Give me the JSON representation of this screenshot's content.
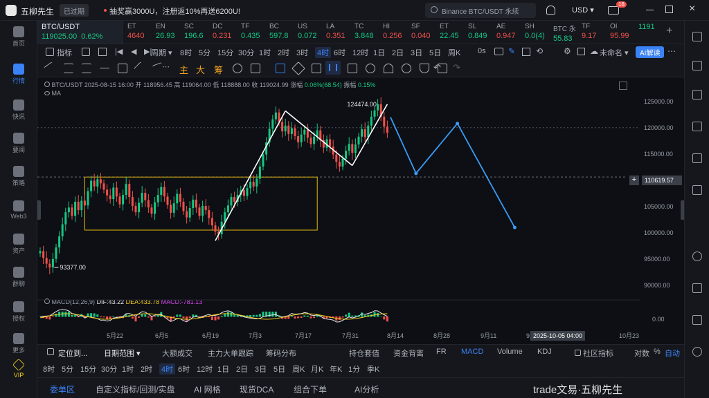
{
  "app": {
    "name": "五柳先生",
    "expired_badge": "已过期",
    "promo": "抽奖赢3000U，注册返10%再送6200U!",
    "search_placeholder": "Binance BTC/USDT 永续",
    "currency": "USD",
    "notif_count": "16"
  },
  "leftnav": [
    {
      "label": "首页"
    },
    {
      "label": "行情",
      "active": true
    },
    {
      "label": "快讯"
    },
    {
      "label": "要闻"
    },
    {
      "label": "策略"
    },
    {
      "label": "Web3"
    },
    {
      "label": "资产"
    },
    {
      "label": "群聊"
    },
    {
      "label": "授权"
    },
    {
      "label": "更多"
    },
    {
      "label": "VIP"
    }
  ],
  "tickers": [
    {
      "name": "BTC/USDT",
      "price": "119025.00",
      "change": "0.62%",
      "dir": "up"
    },
    {
      "name": "ET",
      "price": "4640",
      "dir": "dn"
    },
    {
      "name": "EN",
      "price": "26.93",
      "dir": "up"
    },
    {
      "name": "SC",
      "price": "196.6",
      "dir": "up"
    },
    {
      "name": "DC",
      "price": "0.231",
      "dir": "dn"
    },
    {
      "name": "TF",
      "price": "0.435",
      "dir": "up"
    },
    {
      "name": "BC",
      "price": "597.8",
      "dir": "up"
    },
    {
      "name": "US",
      "price": "0.072",
      "dir": "up"
    },
    {
      "name": "LA",
      "price": "0.351",
      "dir": "dn"
    },
    {
      "name": "TC",
      "price": "3.848",
      "dir": "up"
    },
    {
      "name": "HI",
      "price": "0.256",
      "dir": "dn"
    },
    {
      "name": "SF",
      "price": "0.040",
      "dir": "dn"
    },
    {
      "name": "ET",
      "price": "22.45",
      "dir": "up"
    },
    {
      "name": "SL",
      "price": "0.849",
      "dir": "up"
    },
    {
      "name": "AE",
      "price": "0.947",
      "dir": "dn"
    },
    {
      "name": "SH",
      "price": "0.0(4)",
      "dir": "up"
    },
    {
      "name": "BTC 永",
      "price": "55.83",
      "dir": "up"
    },
    {
      "name": "TF",
      "price": "9.17",
      "dir": "dn"
    },
    {
      "name": "OI",
      "price": "95.99",
      "dir": "dn"
    },
    {
      "name": "",
      "price": "1191",
      "dir": "up"
    }
  ],
  "toolbar1": {
    "indicator": "指标",
    "period": "周期",
    "intervals": [
      "8时",
      "5分",
      "15分",
      "30分",
      "1时",
      "2时",
      "3时",
      "4时",
      "6时",
      "12时",
      "1日",
      "2日",
      "3日",
      "5日",
      "周K"
    ],
    "active_interval": "4时",
    "seconds": "0s",
    "unnamed": "未命名",
    "ai_button": "AI解读"
  },
  "toolbar2": {
    "main": "主",
    "big": "大",
    "chip": "筹"
  },
  "chart_header": {
    "symbol": "BTC/USDT",
    "datetime": "2025-08-15 16:00",
    "open_label": "开",
    "open": "118956.45",
    "high_label": "高",
    "high": "119064.00",
    "low_label": "低",
    "low": "118888.00",
    "close_label": "收",
    "close": "119024.99",
    "chg_label": "涨幅",
    "chg": "0.06%(68.54)",
    "amp_label": "振幅",
    "amp": "0.15%",
    "ma": "MA"
  },
  "chart_data": {
    "type": "candlestick",
    "y_ticks": [
      "125000.00",
      "120000.00",
      "115000.00",
      "110000.00",
      "105000.00",
      "100000.00",
      "95000.00",
      "90000.00"
    ],
    "x_ticks": [
      "5月22",
      "6月5",
      "6月19",
      "7月3",
      "7月17",
      "7月31",
      "8月14",
      "8月28",
      "9月11",
      "9月2",
      "10月23"
    ],
    "crosshair_price": "110619.57",
    "crosshair_date": "2025-10-05 04:00",
    "high_label": "124474.00",
    "low_label": "93377.00",
    "close_series": [
      96500,
      95200,
      94100,
      93377,
      95000,
      97200,
      99300,
      101600,
      103900,
      104800,
      103200,
      105900,
      104300,
      106100,
      105200,
      107900,
      109900,
      108800,
      110200,
      109400,
      108200,
      107100,
      106400,
      108600,
      106900,
      105400,
      107200,
      109300,
      106800,
      105100,
      103900,
      105700,
      107600,
      106200,
      104800,
      103600,
      105800,
      107200,
      108700,
      106900,
      105300,
      103800,
      105600,
      107400,
      105900,
      104100,
      102900,
      104700,
      106300,
      104800,
      103200,
      105100,
      104300,
      102800,
      101400,
      100200,
      99700,
      102100,
      103900,
      105200,
      106800,
      105900,
      107200,
      108100,
      107000,
      108500,
      109700,
      108800,
      110300,
      112600,
      114900,
      117200,
      119800,
      121600,
      122900,
      121100,
      119300,
      120400,
      118800,
      119900,
      118400,
      117200,
      118700,
      119600,
      118100,
      116900,
      118300,
      119500,
      117600,
      116200,
      117800,
      116400,
      114900,
      113500,
      112600,
      114100,
      115600,
      116900,
      115200,
      116800,
      118300,
      119700,
      118200,
      120400,
      122100,
      123300,
      124474,
      122100,
      120200,
      119025
    ],
    "macd": {
      "label": "MACD(12,26,9)",
      "dif": "DIF:43.22",
      "dea": "DEA:433.78",
      "macd": "MACD:-781.13",
      "zero_tick": "0.00"
    },
    "consolidation_box": {
      "x_start_index": 14,
      "x_end_index": 87,
      "y_top": 110600,
      "y_bottom": 100500
    },
    "annotations": "white zigzag up legs, blue projected path"
  },
  "bottombar1": {
    "locate": "定位到...",
    "date_range": "日期范围",
    "tabs": [
      "大额成交",
      "主力大单跟踪",
      "筹码分布",
      "持仓套值",
      "资金背离",
      "FR",
      "MACD",
      "Volume",
      "KDJ"
    ],
    "active_tab": "MACD",
    "community": "社区指标",
    "log": "对数",
    "pct": "%",
    "auto": "自动"
  },
  "bottombar2": {
    "intervals": [
      "8时",
      "5分",
      "15分",
      "30分",
      "1时",
      "2时",
      "4时",
      "6时",
      "12时",
      "1日",
      "2日",
      "3日",
      "5日",
      "周K",
      "月K",
      "年K",
      "1分",
      "季K"
    ],
    "active_interval": "4时"
  },
  "bottombar3": {
    "tabs": [
      "委单区",
      "自定义指标/回测/实盘",
      "AI 网格",
      "现货DCA",
      "组合下单",
      "AI分析"
    ],
    "active_tab": "委单区",
    "watermark": "trade文易·五柳先生"
  }
}
